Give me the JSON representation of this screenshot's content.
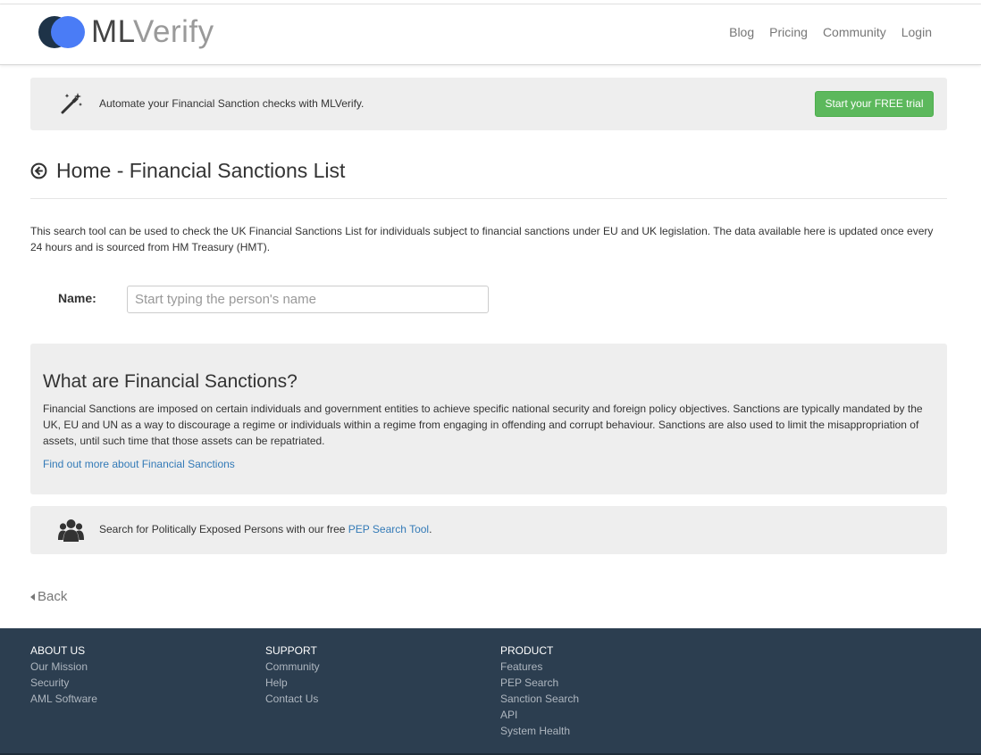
{
  "header": {
    "logo": {
      "part1": "ML",
      "part2": "Verify"
    },
    "nav": [
      "Blog",
      "Pricing",
      "Community",
      "Login"
    ]
  },
  "promo": {
    "icon": "magic-wand-icon",
    "text": "Automate your Financial Sanction checks with MLVerify.",
    "button_label": "Start your FREE trial",
    "button_color": "#5cb85c"
  },
  "page": {
    "title": "Home - Financial Sanctions List",
    "intro": "This search tool can be used to check the UK Financial Sanctions List for individuals subject to financial sanctions under EU and UK legislation. The data available here is updated once every 24 hours and is sourced from HM Treasury (HMT)."
  },
  "search": {
    "label": "Name:",
    "placeholder": "Start typing the person's name",
    "value": ""
  },
  "info": {
    "heading": "What are Financial Sanctions?",
    "body": "Financial Sanctions are imposed on certain individuals and government entities to achieve specific national security and foreign policy objectives. Sanctions are typically mandated by the UK, EU and UN as a way to discourage a regime or individuals within a regime from engaging in offending and corrupt behaviour. Sanctions are also used to limit the misappropriation of assets, until such time that those assets can be repatriated.",
    "link": "Find out more about Financial Sanctions",
    "link_color": "#337ab7"
  },
  "pep": {
    "icon": "users-icon",
    "text_before": "Search for Politically Exposed Persons with our free ",
    "link": "PEP Search Tool",
    "text_after": "."
  },
  "back_label": "Back",
  "footer": {
    "background": "#2c3e50",
    "columns": [
      {
        "title": "ABOUT US",
        "links": [
          "Our Mission",
          "Security",
          "AML Software"
        ]
      },
      {
        "title": "SUPPORT",
        "links": [
          "Community",
          "Help",
          "Contact Us"
        ]
      },
      {
        "title": "PRODUCT",
        "links": [
          "Features",
          "PEP Search",
          "Sanction Search",
          "API",
          "System Health"
        ]
      }
    ]
  }
}
